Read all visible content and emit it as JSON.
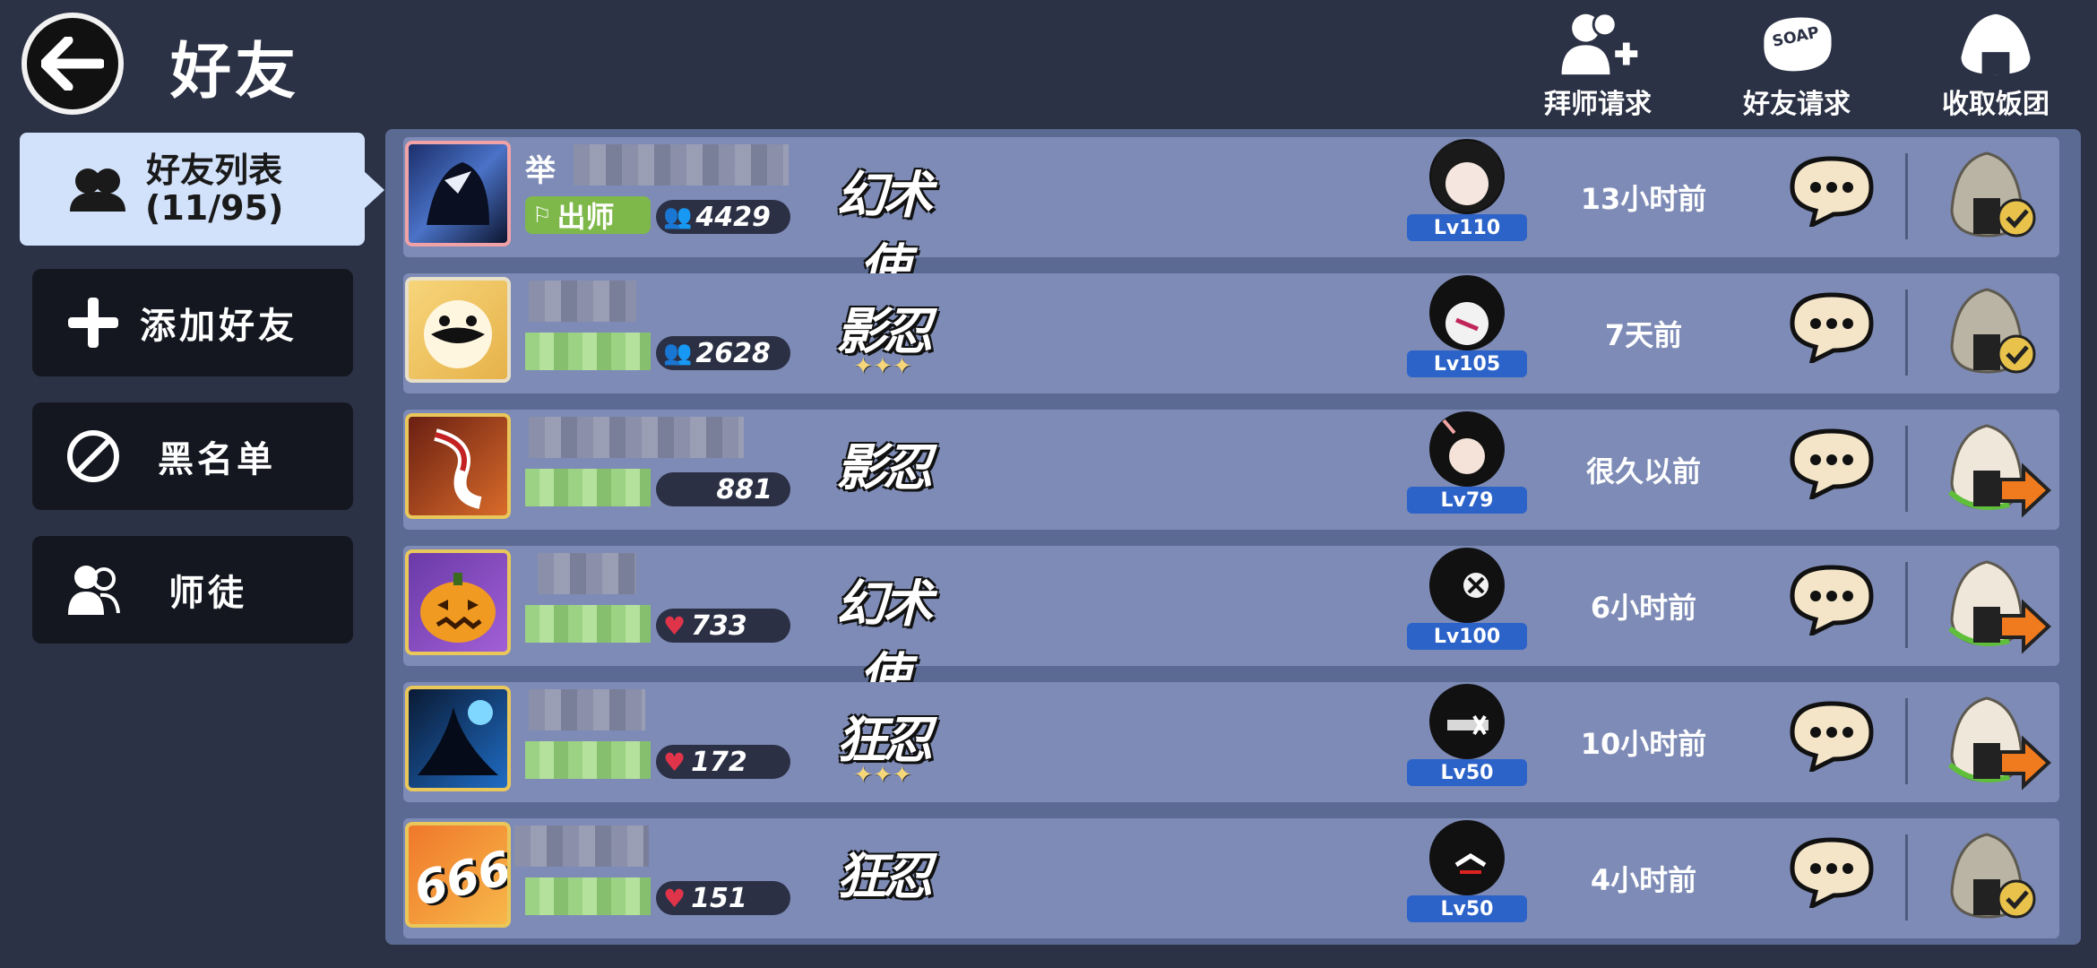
{
  "header": {
    "title": "好友",
    "actions": [
      {
        "label": "拜师请求",
        "icon": "person-plus-icon"
      },
      {
        "label": "好友请求",
        "icon": "soap-icon",
        "icon_text": "SOAP"
      },
      {
        "label": "收取饭团",
        "icon": "rice-ball-icon"
      }
    ]
  },
  "sidebar": {
    "active": {
      "label": "好友列表",
      "count": "(11/95)"
    },
    "items": [
      {
        "label": "添加好友",
        "icon": "plus-icon"
      },
      {
        "label": "黑名单",
        "icon": "block-icon"
      },
      {
        "label": "师徒",
        "icon": "mentor-icon"
      }
    ]
  },
  "friends": [
    {
      "name": "举",
      "badge": "出师",
      "stat": "4429",
      "stat_icon": "group-icon",
      "class": "幻术使",
      "level": "Lv110",
      "last_seen": "13小时前",
      "gift": "received"
    },
    {
      "name": "",
      "badge": "",
      "stat": "2628",
      "stat_icon": "group-icon",
      "class": "影忍",
      "level": "Lv105",
      "last_seen": "7天前",
      "gift": "received"
    },
    {
      "name": "",
      "badge": "",
      "stat": "881",
      "stat_icon": "",
      "class": "影忍",
      "level": "Lv79",
      "last_seen": "很久以前",
      "gift": "send"
    },
    {
      "name": "",
      "badge": "",
      "stat": "733",
      "stat_icon": "heart-icon",
      "class": "幻术使",
      "level": "Lv100",
      "last_seen": "6小时前",
      "gift": "send"
    },
    {
      "name": "",
      "badge": "",
      "stat": "172",
      "stat_icon": "heart-icon",
      "class": "狂忍",
      "level": "Lv50",
      "last_seen": "10小时前",
      "gift": "send"
    },
    {
      "name": "",
      "badge": "",
      "stat": "151",
      "stat_icon": "heart-icon",
      "class": "狂忍",
      "level": "Lv50",
      "last_seen": "4小时前",
      "gift": "received",
      "avatar_text": "666"
    }
  ],
  "colors": {
    "background": "#2c3245",
    "panel": "#5a6a92",
    "row": "#7d8bb6",
    "menu_active": "#d2e2fb",
    "level_badge": "#2c63c9"
  }
}
